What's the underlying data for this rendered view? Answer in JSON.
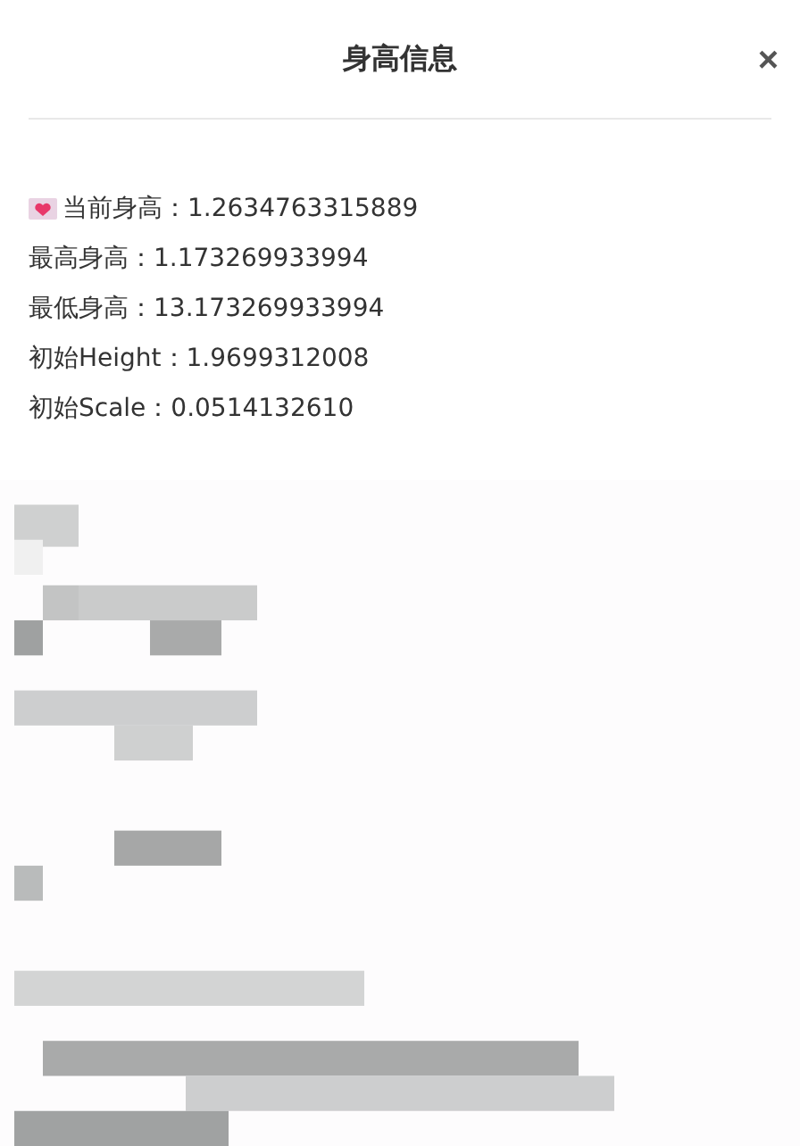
{
  "dialog": {
    "title": "身高信息",
    "close": "×"
  },
  "lines": [
    {
      "kind": "heart",
      "text": "当前身高：1.2634763315889"
    },
    {
      "kind": "plain",
      "text": "最高身高：1.173269933994"
    },
    {
      "kind": "plain",
      "text": "最低身高：13.173269933994"
    },
    {
      "kind": "plain",
      "text": "初始Height：1.9699312008"
    },
    {
      "kind": "plain",
      "text": "初始Scale：0.0514132610"
    }
  ]
}
